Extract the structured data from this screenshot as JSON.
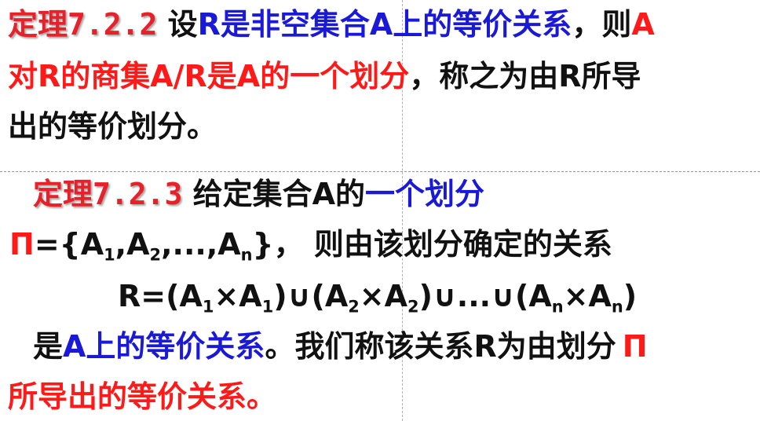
{
  "colors": {
    "title_red": "#e8202a",
    "highlight_red": "#ff1a1a",
    "highlight_blue": "#1a1ad6",
    "text": "#111111"
  },
  "theorem1": {
    "title": "定理7.2.2",
    "line1_p1": "设",
    "line1_p2": "R是非空集合A上的等价关系",
    "line1_p3": "，则",
    "line1_p4": "A",
    "line2_p1": "对R的商集A/R是A的一个划分",
    "line2_p2": "，称之为由R所导",
    "line3": "出的等价划分。"
  },
  "theorem2": {
    "title": "定理7.2.3",
    "line1_p1": "给定集合A的",
    "line1_p2": "一个划分",
    "pi_symbol": "Π",
    "line2_p1": "={A",
    "sub1": "1",
    "comma1": ",A",
    "sub2": "2",
    "comma2": ",...,A",
    "subn": "n",
    "line2_p2": "}， 则由该划分确定的关系",
    "formula_p1": "R=(A",
    "formula_s1": "1",
    "formula_p2": "×A",
    "formula_s2": "1",
    "formula_p3": ")∪(A",
    "formula_s3": "2",
    "formula_p4": "×A",
    "formula_s4": "2",
    "formula_p5": ")∪...∪(A",
    "formula_s5": "n",
    "formula_p6": "×A",
    "formula_s6": "n",
    "formula_p7": ")",
    "line4_p1": "是",
    "line4_p2": "A上的等价关系",
    "line4_p3": "。我们称该关系R为由划分",
    "pi_symbol2": "Π",
    "line5": "所导出的等价关系。"
  }
}
